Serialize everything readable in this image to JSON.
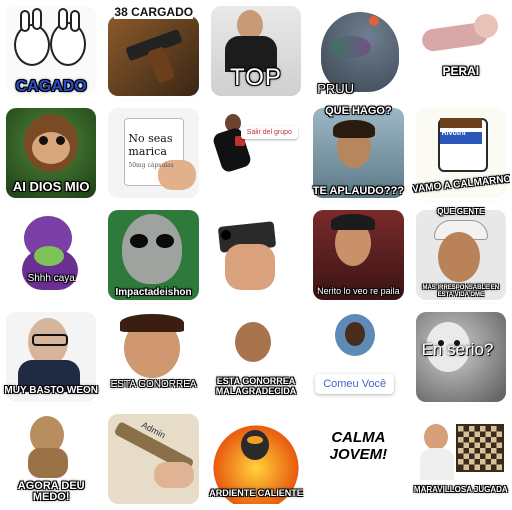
{
  "stickers": [
    {
      "id": "bunnies",
      "caption": "CAGADO"
    },
    {
      "id": "gun-cargado",
      "caption": "38 CARGADO"
    },
    {
      "id": "top",
      "caption": "TOP"
    },
    {
      "id": "pigeon",
      "caption": "PRUU"
    },
    {
      "id": "perai",
      "caption": "PERAI"
    },
    {
      "id": "monkey",
      "caption": "AI DIOS MIO"
    },
    {
      "id": "pills-box",
      "box_text": "No seas marica",
      "small_text": "50mg cápsulas"
    },
    {
      "id": "salir-grupo",
      "caption": "Salir del grupo"
    },
    {
      "id": "que-hago",
      "caption_top": "QUE HAGO?",
      "caption_bottom": "TE APLAUDO???"
    },
    {
      "id": "calmarno",
      "caption": "VAMO A CALMARNO",
      "label": "Rivotril"
    },
    {
      "id": "barney",
      "caption": "Shhh caya"
    },
    {
      "id": "alien",
      "caption": "Impactadeishon"
    },
    {
      "id": "gun-hand",
      "caption": ""
    },
    {
      "id": "nerito",
      "caption": "Nerito lo veo re paila"
    },
    {
      "id": "que-gente",
      "caption_top": "QUE GENTE",
      "caption_bottom": "MAS IRRESPONSABLE EN ESTA VIDA OME"
    },
    {
      "id": "muy-basto",
      "caption": "MUY BASTO WEON"
    },
    {
      "id": "esta-gonorrea",
      "caption": "ESTA GONORREA"
    },
    {
      "id": "malagradecida",
      "caption": "ESTA GONORREA MALAGRADECIDA"
    },
    {
      "id": "comeu-voce",
      "caption": "Comeu Você"
    },
    {
      "id": "en-serio",
      "caption": "En serio?"
    },
    {
      "id": "agora-medo",
      "caption": "AGORA DEU MEDO!"
    },
    {
      "id": "admin",
      "caption": "Admin"
    },
    {
      "id": "ardiente",
      "caption": "ARDIENTE CALIENTE"
    },
    {
      "id": "calma-jovem",
      "caption": "CALMA JOVEM!"
    },
    {
      "id": "maravillosa",
      "caption": "MARAVILLOSA JUGADA"
    }
  ],
  "colors": {
    "outline": "#ffffff",
    "caption_text": "#ffffff",
    "caption_stroke": "#000000",
    "link_blue": "#4a63c7",
    "alert_red": "#c23030"
  }
}
